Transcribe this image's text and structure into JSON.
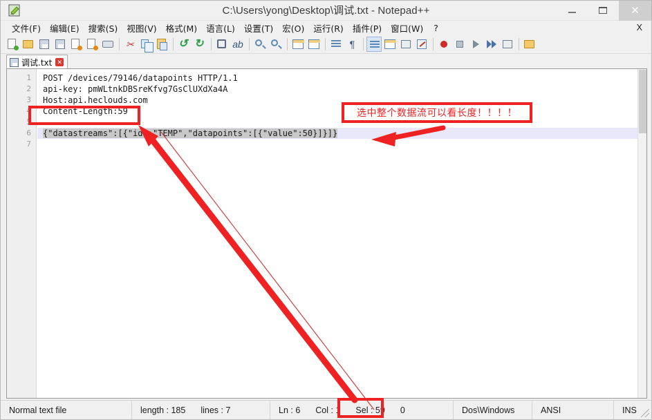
{
  "window": {
    "title": "C:\\Users\\yong\\Desktop\\调试.txt - Notepad++",
    "icon_name": "notepad-plus-plus-icon",
    "controls": {
      "minimize": "—",
      "maximize": "▢",
      "close": "✕"
    }
  },
  "menu": {
    "items": [
      {
        "label": "文件(F)",
        "name": "menu-file"
      },
      {
        "label": "编辑(E)",
        "name": "menu-edit"
      },
      {
        "label": "搜索(S)",
        "name": "menu-search"
      },
      {
        "label": "视图(V)",
        "name": "menu-view"
      },
      {
        "label": "格式(M)",
        "name": "menu-format"
      },
      {
        "label": "语言(L)",
        "name": "menu-language"
      },
      {
        "label": "设置(T)",
        "name": "menu-settings"
      },
      {
        "label": "宏(O)",
        "name": "menu-macro"
      },
      {
        "label": "运行(R)",
        "name": "menu-run"
      },
      {
        "label": "插件(P)",
        "name": "menu-plugins"
      },
      {
        "label": "窗口(W)",
        "name": "menu-window"
      },
      {
        "label": "?",
        "name": "menu-help"
      }
    ],
    "close_document": "X"
  },
  "toolbar": {
    "icons": [
      "new-file-icon",
      "open-file-icon",
      "save-icon",
      "save-all-icon",
      "close-file-icon",
      "close-all-icon",
      "print-icon",
      "cut-icon",
      "copy-icon",
      "paste-icon",
      "undo-icon",
      "redo-icon",
      "find-icon",
      "replace-icon",
      "zoom-in-icon",
      "zoom-out-icon",
      "sync-vertical-icon",
      "sync-horizontal-icon",
      "word-wrap-icon",
      "show-all-characters-icon",
      "indent-guide-icon",
      "user-defined-dialog-icon",
      "show-documents-list-icon",
      "function-list-icon",
      "macro-record-icon",
      "macro-stop-icon",
      "macro-play-icon",
      "macro-play-multiple-icon",
      "macro-save-icon",
      "open-folder-as-workspace-icon"
    ]
  },
  "tab": {
    "label": "调试.txt",
    "icon_name": "saved-document-icon",
    "close_glyph": "✕"
  },
  "editor": {
    "line_numbers": [
      "1",
      "2",
      "3",
      "4",
      "5",
      "6",
      "7"
    ],
    "lines": [
      "POST /devices/79146/datapoints HTTP/1.1",
      "api-key: pmWLtnkDBSreKfvg7GsClUXdXa4A",
      "Host:api.heclouds.com",
      "Content-Length:59",
      "",
      "{\"datastreams\":[{\"id\":\"TEMP\",\"datapoints\":[{\"value\":50}]}]}",
      ""
    ],
    "selected_line_index": 5,
    "selection_text": "{\"datastreams\":[{\"id\":\"TEMP\",\"datapoints\":[{\"value\":50}]}]}"
  },
  "statusbar": {
    "file_type": "Normal text file",
    "length_label": "length : 185",
    "lines_label": "lines : 7",
    "ln_label": "Ln : 6",
    "col_label": "Col : 1",
    "sel_label": "Sel : 59",
    "sel_extra": "0",
    "eol": "Dos\\Windows",
    "encoding": "ANSI",
    "insert_mode": "INS"
  },
  "annotations": {
    "note_text": "选中整个数据流可以看长度！！！！",
    "accent_color": "#ee2222",
    "boxes": [
      {
        "name": "content-length-highlight-box"
      },
      {
        "name": "sel-count-highlight-box"
      }
    ]
  }
}
